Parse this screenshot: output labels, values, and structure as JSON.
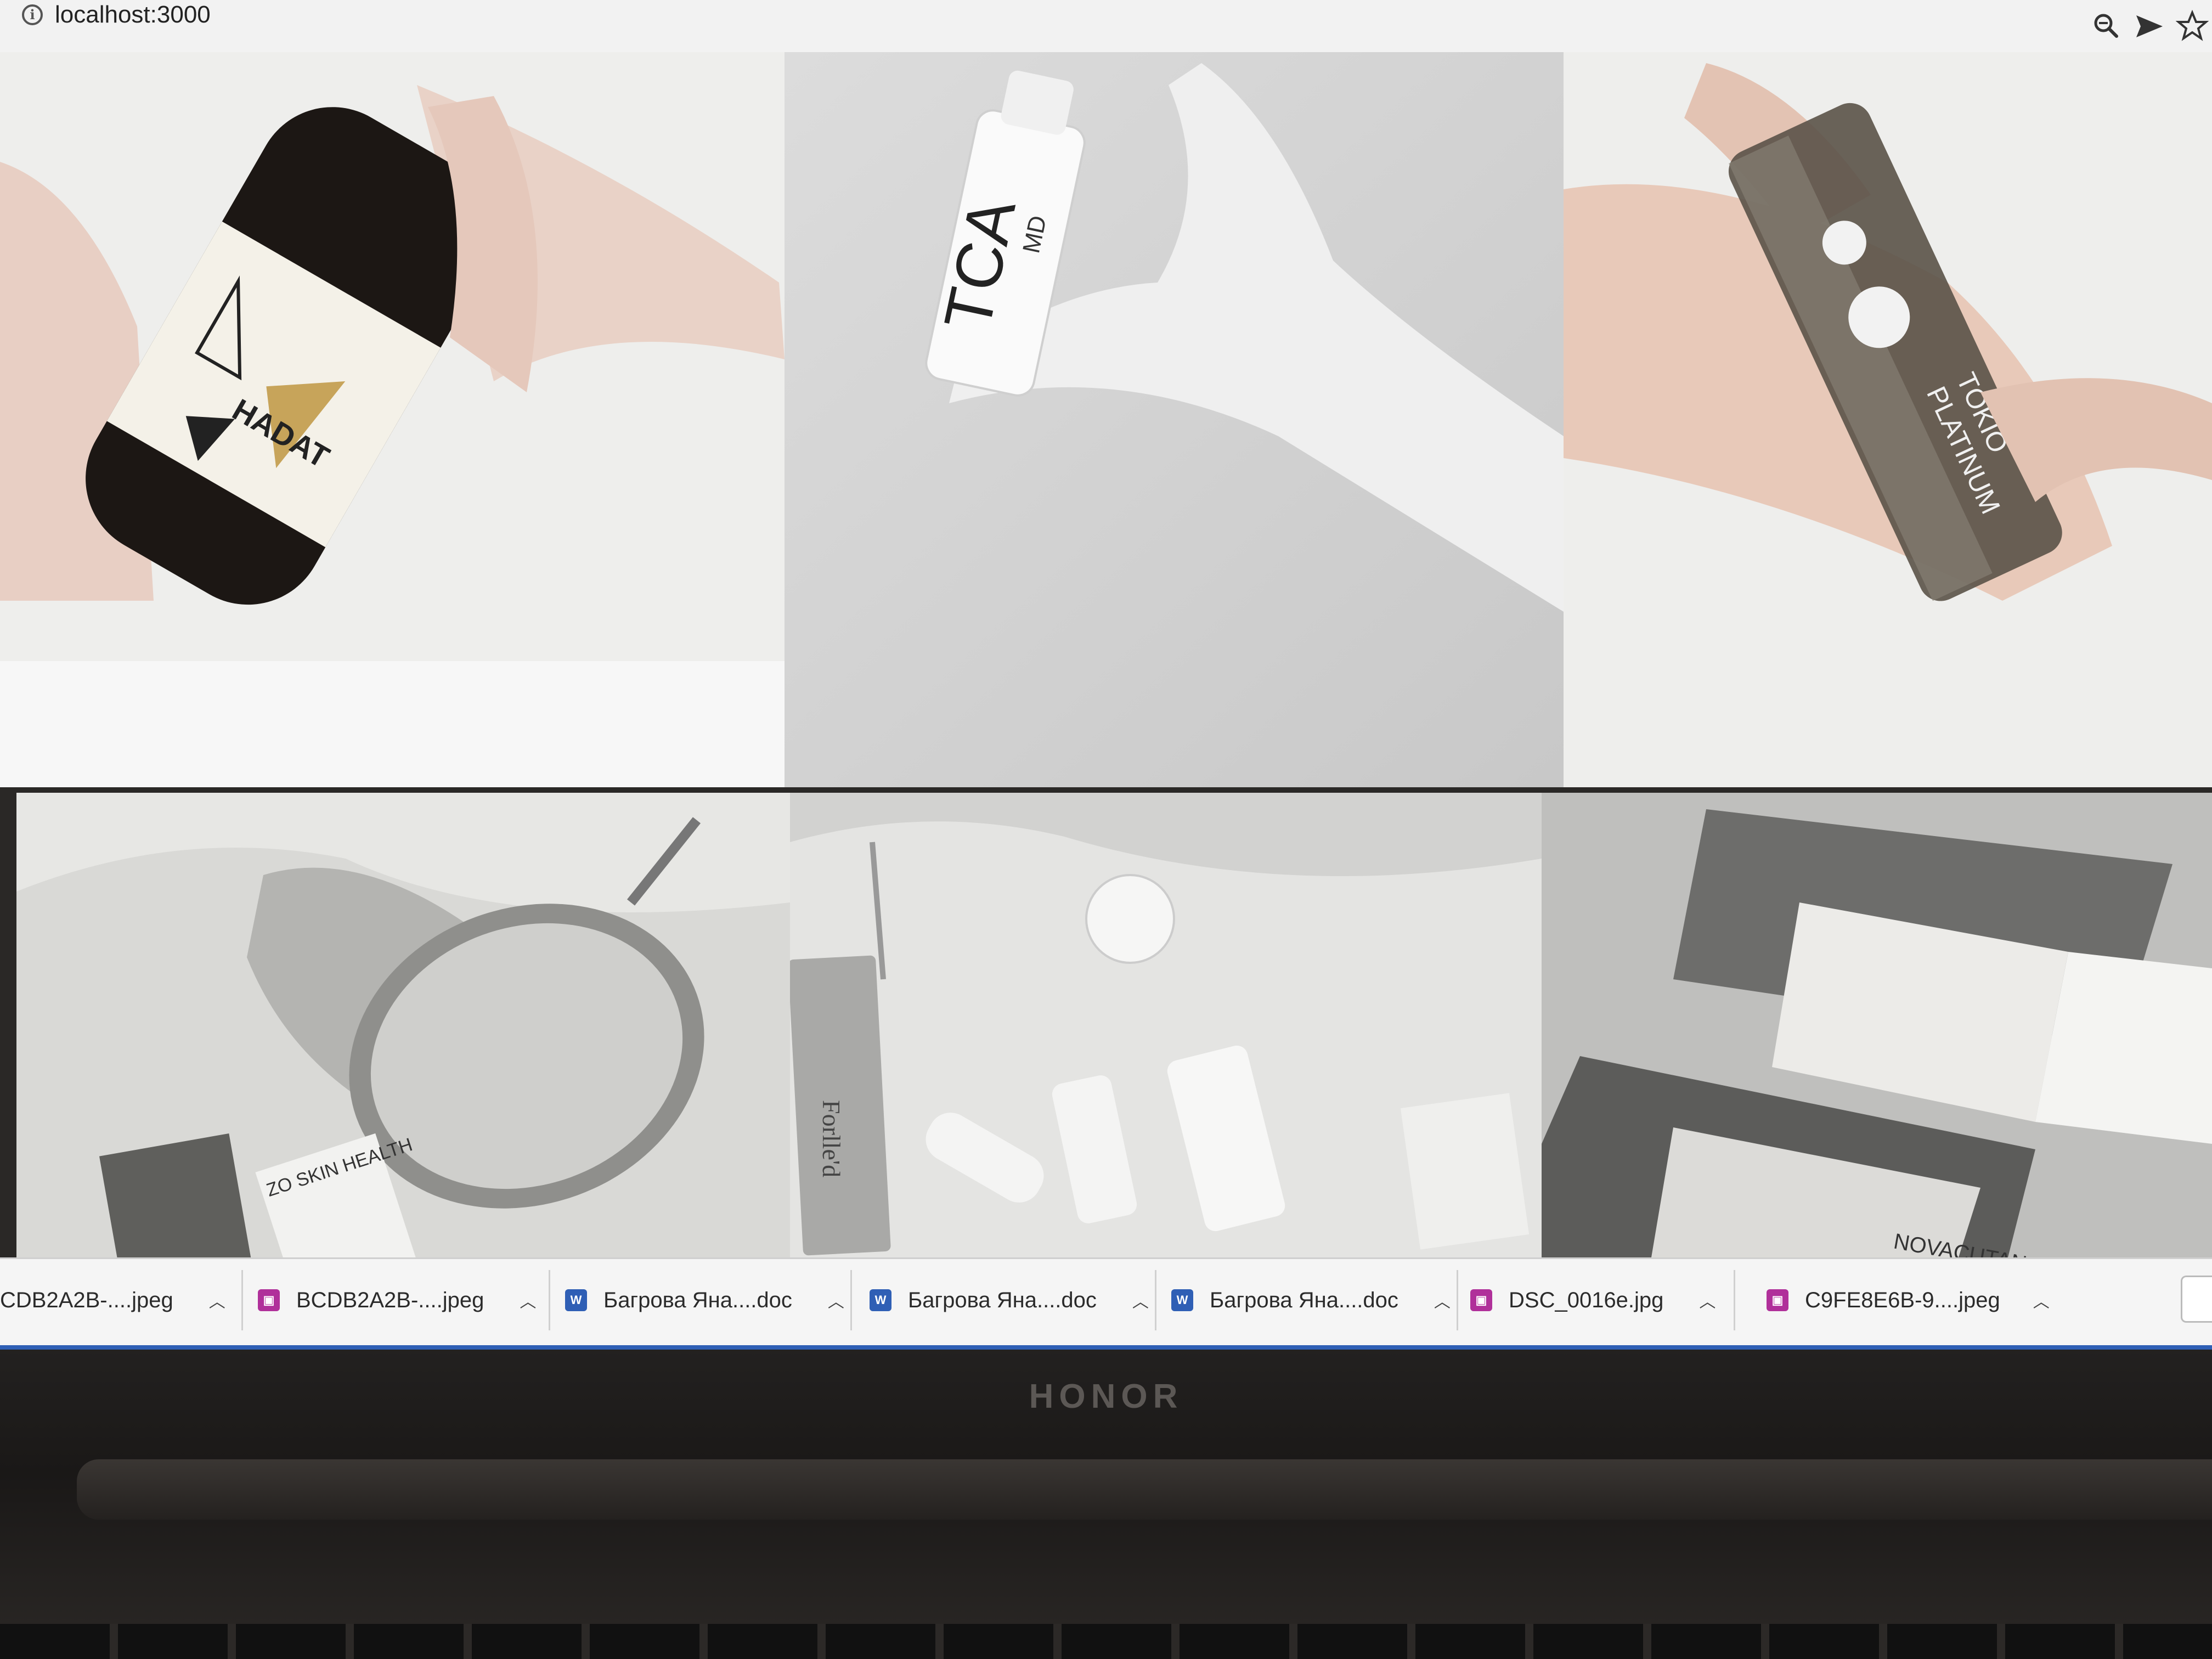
{
  "browser": {
    "url": "localhost:3000",
    "icons": [
      "info-icon",
      "zoom-out-icon",
      "send-icon",
      "bookmark-star-icon"
    ]
  },
  "gallery": {
    "tiles": [
      {
        "name": "tile-hadat-bottle",
        "label_lines": [
          "HADAT"
        ]
      },
      {
        "name": "tile-tca-gloved-hand",
        "label_lines": [
          "TCA",
          "MD"
        ]
      },
      {
        "name": "tile-tokio-platinum",
        "label_lines": [
          "TOKIO",
          "PLATINUM"
        ]
      },
      {
        "name": "tile-mirror-zo-skin",
        "label_lines": [
          "ZO SKIN HEALTH"
        ]
      },
      {
        "name": "tile-forlled-products",
        "label_lines": [
          "Forlle'd"
        ]
      },
      {
        "name": "tile-novacutan-boxes",
        "label_lines": [
          "NOVACUTAN"
        ]
      }
    ]
  },
  "downloads": {
    "items": [
      {
        "name": "CDB2A2B-....jpeg",
        "icon": "image-file-icon",
        "color": "#b0309a"
      },
      {
        "name": "BCDB2A2B-....jpeg",
        "icon": "image-file-icon",
        "color": "#b0309a"
      },
      {
        "name": "Багрова Яна....doc",
        "icon": "doc-file-icon",
        "color": "#2f5fb5"
      },
      {
        "name": "Багрова Яна....doc",
        "icon": "doc-file-icon",
        "color": "#2f5fb5"
      },
      {
        "name": "Багрова Яна....doc",
        "icon": "doc-file-icon",
        "color": "#2f5fb5"
      },
      {
        "name": "DSC_0016e.jpg",
        "icon": "image-file-icon",
        "color": "#b0309a"
      },
      {
        "name": "C9FE8E6B-9....jpeg",
        "icon": "image-file-icon",
        "color": "#b0309a"
      }
    ]
  },
  "laptop": {
    "brand": "HONOR"
  }
}
